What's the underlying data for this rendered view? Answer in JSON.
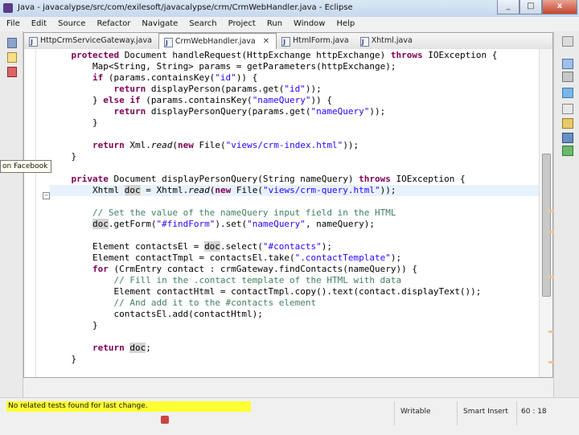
{
  "window": {
    "title": "Java - javacalypse/src/com/exilesoft/javacalypse/crm/CrmWebHandler.java - Eclipse",
    "minimize": "_",
    "maximize": "□",
    "close": "x"
  },
  "menu": [
    "File",
    "Edit",
    "Source",
    "Refactor",
    "Navigate",
    "Search",
    "Project",
    "Run",
    "Window",
    "Help"
  ],
  "tooltip": "on Facebook",
  "tabs": [
    {
      "label": "HttpCrmServiceGateway.java",
      "close": ""
    },
    {
      "label": "CrmWebHandler.java",
      "close": "✕"
    },
    {
      "label": "HtmlForm.java",
      "close": ""
    },
    {
      "label": "Xhtml.java",
      "close": ""
    }
  ],
  "status": {
    "message": "No related tests found for last change.",
    "mode": "Writable",
    "insert": "Smart Insert",
    "position": "60 : 18"
  },
  "colors": {
    "keyword": "#7f0055",
    "string": "#2a00ff",
    "comment": "#3f7f5f",
    "status_highlight": "#ffff33",
    "current_line": "#e8f2fe"
  },
  "icons": [
    "eclipse-app-icon",
    "close-tab-icon",
    "java-file-icon",
    "fold-icon",
    "warning-icon",
    "outline-icon"
  ]
}
